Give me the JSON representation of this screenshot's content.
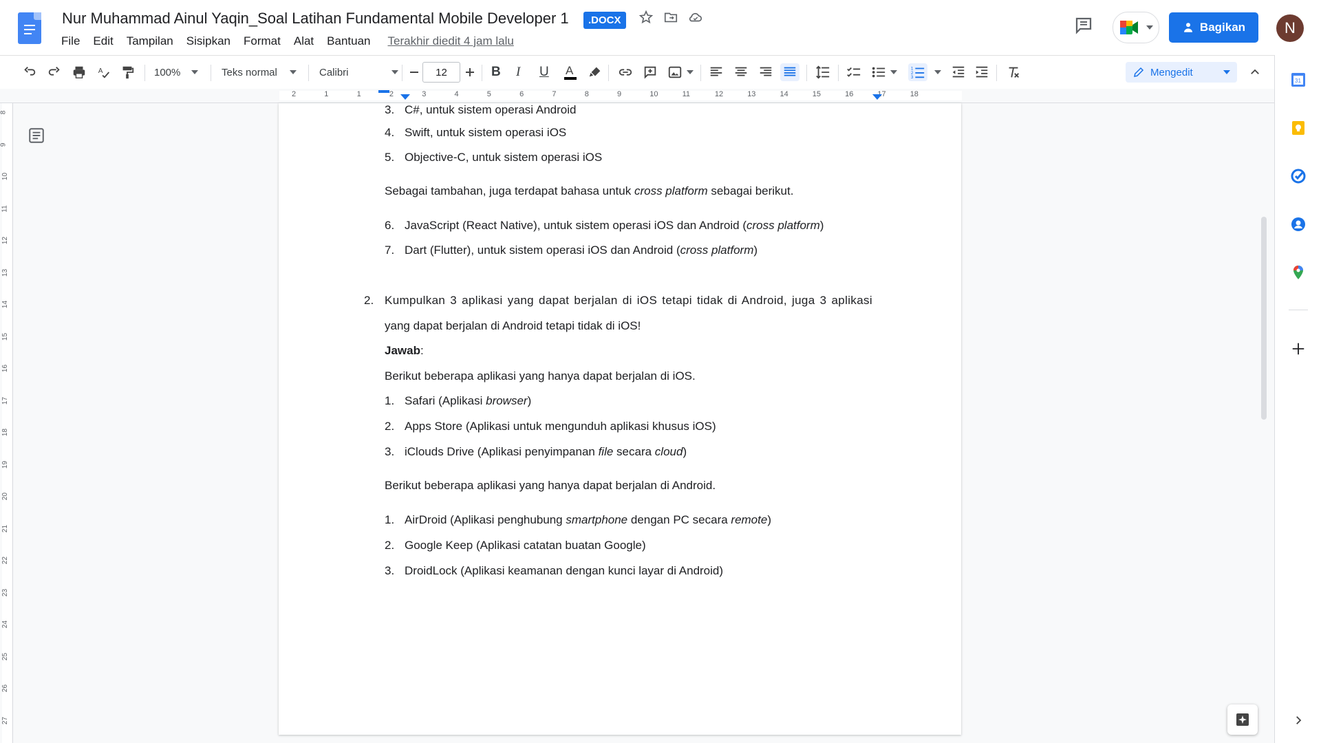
{
  "header": {
    "title": "Nur Muhammad Ainul Yaqin_Soal Latihan Fundamental Mobile Developer 1",
    "badge": ".DOCX",
    "menu": [
      "File",
      "Edit",
      "Tampilan",
      "Sisipkan",
      "Format",
      "Alat",
      "Bantuan"
    ],
    "last_edit": "Terakhir diedit 4 jam lalu",
    "share_label": "Bagikan",
    "avatar_letter": "N"
  },
  "toolbar": {
    "zoom": "100%",
    "style": "Teks normal",
    "font": "Calibri",
    "font_size": "12",
    "mode": "Mengedit"
  },
  "ruler": {
    "numbers": [
      "2",
      "1",
      "1",
      "2",
      "3",
      "4",
      "5",
      "6",
      "7",
      "8",
      "9",
      "10",
      "11",
      "12",
      "13",
      "14",
      "15",
      "16",
      "17",
      "18"
    ],
    "vertical": [
      "8",
      "9",
      "10",
      "11",
      "12",
      "13",
      "14",
      "15",
      "16",
      "17",
      "18",
      "19",
      "20",
      "21",
      "22",
      "23",
      "24",
      "25",
      "26",
      "27"
    ]
  },
  "document": {
    "list_a": [
      {
        "n": "3.",
        "text": "C#, untuk sistem operasi Android"
      },
      {
        "n": "4.",
        "text": "Swift, untuk sistem operasi iOS"
      },
      {
        "n": "5.",
        "text": "Objective-C, untuk sistem operasi iOS"
      }
    ],
    "cross_intro": {
      "pre": "Sebagai tambahan, juga terdapat bahasa untuk ",
      "em": "cross platform",
      "post": " sebagai berikut."
    },
    "list_b": [
      {
        "n": "6.",
        "pre": "JavaScript (React Native), untuk sistem operasi iOS dan Android (",
        "em": "cross platform",
        "post": ")"
      },
      {
        "n": "7.",
        "pre": "Dart (Flutter), untuk sistem operasi iOS dan Android (",
        "em": "cross platform",
        "post": ")"
      }
    ],
    "q2_number": "2.",
    "q2_line1": "Kumpulkan 3 aplikasi yang dapat berjalan di iOS tetapi tidak di Android, juga 3 aplikasi",
    "q2_line2": "yang dapat berjalan di Android tetapi tidak di iOS!",
    "answer_label": "Jawab",
    "answer_colon": ":",
    "ios_intro": "Berikut beberapa aplikasi yang hanya dapat berjalan di iOS.",
    "ios_list": [
      {
        "n": "1.",
        "pre": "Safari (Aplikasi ",
        "em": "browser",
        "mid": "",
        "em2": "",
        "post": ")"
      },
      {
        "n": "2.",
        "pre": "Apps Store (Aplikasi untuk mengunduh aplikasi khusus iOS)",
        "em": "",
        "mid": "",
        "em2": "",
        "post": ""
      },
      {
        "n": "3.",
        "pre": "iClouds Drive (Aplikasi penyimpanan ",
        "em": "file",
        "mid": " secara ",
        "em2": "cloud",
        "post": ")"
      }
    ],
    "android_intro": "Berikut beberapa aplikasi yang hanya dapat berjalan di Android.",
    "android_list": [
      {
        "n": "1.",
        "pre": "AirDroid (Aplikasi penghubung ",
        "em": "smartphone",
        "mid": " dengan PC secara ",
        "em2": "remote",
        "post": ")"
      },
      {
        "n": "2.",
        "pre": "Google Keep (Aplikasi catatan buatan Google)",
        "em": "",
        "mid": "",
        "em2": "",
        "post": ""
      },
      {
        "n": "3.",
        "pre": "DroidLock (Aplikasi keamanan dengan kunci layar di Android)",
        "em": "",
        "mid": "",
        "em2": "",
        "post": ""
      }
    ]
  },
  "colors": {
    "accent": "#1a73e8",
    "avatar": "#6d3b30"
  }
}
